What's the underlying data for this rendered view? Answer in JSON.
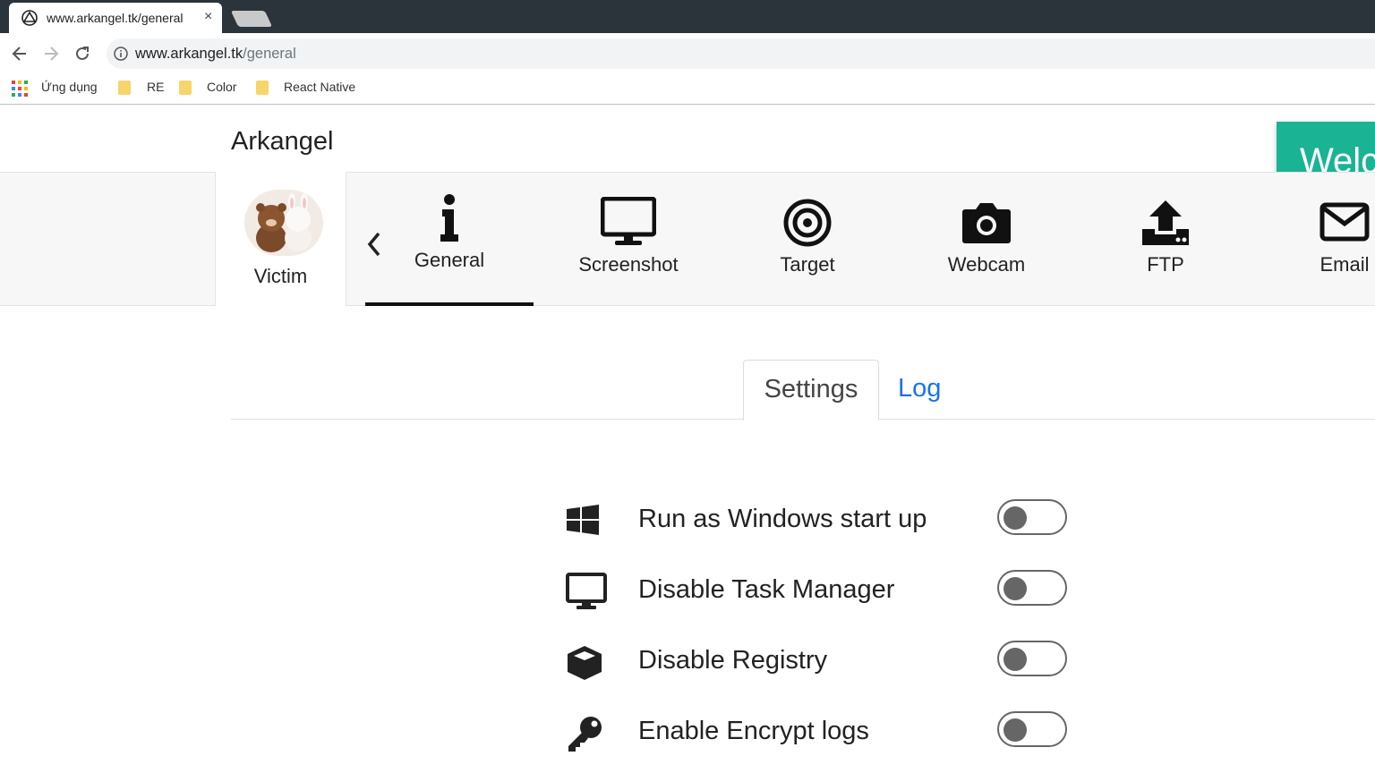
{
  "browser": {
    "tab_title": "www.arkangel.tk/general",
    "tab_close": "×",
    "url_host": "www.arkangel.tk",
    "url_path": "/general",
    "bookmarks": [
      "Ứng dụng",
      "RE",
      "Color",
      "React Native"
    ]
  },
  "app": {
    "brand": "Arkangel",
    "welcome_text": "Welc",
    "victim_label": "Victim",
    "menu": [
      {
        "label": "General",
        "icon": "info-icon",
        "active": true
      },
      {
        "label": "Screenshot",
        "icon": "monitor-icon"
      },
      {
        "label": "Target",
        "icon": "target-icon"
      },
      {
        "label": "Webcam",
        "icon": "camera-icon"
      },
      {
        "label": "FTP",
        "icon": "upload-icon"
      },
      {
        "label": "Email",
        "icon": "envelope-icon"
      }
    ],
    "subtabs": {
      "settings": "Settings",
      "log": "Log"
    },
    "settings": [
      {
        "label": "Run as Windows start up",
        "icon": "windows-icon",
        "enabled": false
      },
      {
        "label": "Disable Task Manager",
        "icon": "monitor-icon",
        "enabled": false
      },
      {
        "label": "Disable Registry",
        "icon": "cube-icon",
        "enabled": false
      },
      {
        "label": "Enable Encrypt logs",
        "icon": "key-icon",
        "enabled": false
      }
    ]
  }
}
